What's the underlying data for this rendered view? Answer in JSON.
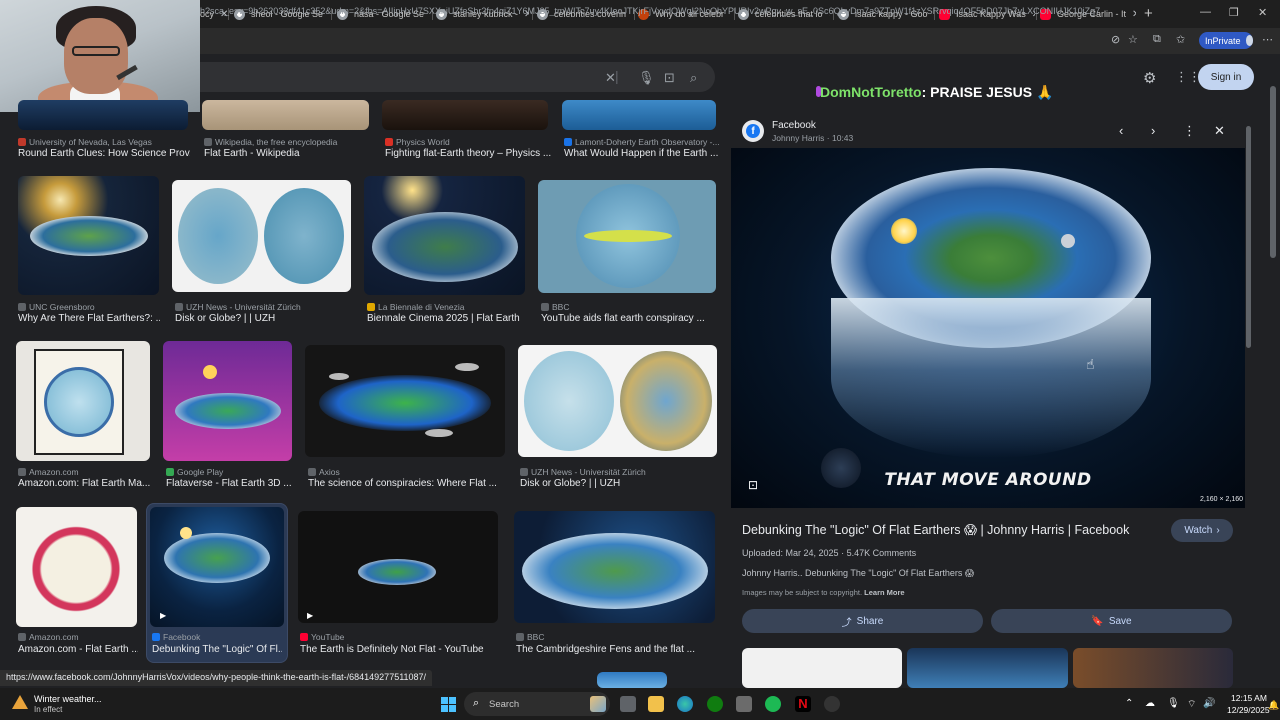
{
  "browser": {
    "tabs": [
      {
        "label": "ocy",
        "favicon": "google"
      },
      {
        "label": "sheol - Google Se",
        "favicon": "google"
      },
      {
        "label": "nasa - Google Se",
        "favicon": "google"
      },
      {
        "label": "stanley kubrick -",
        "favicon": "google"
      },
      {
        "label": "celebrities coverin",
        "favicon": "google"
      },
      {
        "label": "Why do all celebr",
        "favicon": "red"
      },
      {
        "label": "celebrities that lo",
        "favicon": "google"
      },
      {
        "label": "isaac kappy - Goo",
        "favicon": "google"
      },
      {
        "label": "Isaac Kappy Was",
        "favicon": "youtube"
      },
      {
        "label": "George Carlin - It",
        "favicon": "youtube"
      }
    ],
    "new_tab": "+",
    "address": "h?sca_esv=9b262033df41c352&udm=2&fbs=AIIjpHxU7SXXniUZfeShr2fp4giZ1Y6MJ25_tmWITc7uy4KIeoJTKjrFjVxydQWqI2NcOhYPURIv2wPgv_w_sE_0Sc6QLvDm7a9ZTpW1f1zYSRrvqiq4OF5bD07JhZyLXCONIUJK10jZg7B...",
    "inprivate_label": "InPrivate"
  },
  "webcam": {
    "description_icon": "webcam-overlay"
  },
  "results": [
    {
      "source": "University of Nevada, Las Vegas",
      "title": "Round Earth Clues: How Science Prov...",
      "fav": "#c0392b"
    },
    {
      "source": "Wikipedia, the free encyclopedia",
      "title": "Flat Earth - Wikipedia",
      "fav": "#9aa0a6"
    },
    {
      "source": "Physics World",
      "title": "Fighting flat-Earth theory – Physics ...",
      "fav": "#d93025"
    },
    {
      "source": "Lamont-Doherty Earth Observatory -...",
      "title": "What Would Happen if the Earth ...",
      "fav": "#1a73e8"
    },
    {
      "source": "UNC Greensboro",
      "title": "Why Are There Flat Earthers?: ...",
      "fav": "#9aa0a6"
    },
    {
      "source": "UZH News - Universität Zürich",
      "title": "Disk or Globe? | | UZH",
      "fav": "#9aa0a6"
    },
    {
      "source": "La Biennale di Venezia",
      "title": "Biennale Cinema 2025 | Flat Earth",
      "fav": "#9aa0a6"
    },
    {
      "source": "BBC",
      "title": "YouTube aids flat earth conspiracy ...",
      "fav": "#9aa0a6"
    },
    {
      "source": "Amazon.com",
      "title": "Amazon.com: Flat Earth Ma...",
      "fav": "#9aa0a6"
    },
    {
      "source": "Google Play",
      "title": "Flataverse - Flat Earth 3D ...",
      "fav": "#34a853"
    },
    {
      "source": "Axios",
      "title": "The science of conspiracies: Where Flat ...",
      "fav": "#9aa0a6"
    },
    {
      "source": "UZH News - Universität Zürich",
      "title": "Disk or Globe? | | UZH",
      "fav": "#9aa0a6"
    },
    {
      "source": "Amazon.com",
      "title": "Amazon.com - Flat Earth ...",
      "fav": "#9aa0a6"
    },
    {
      "source": "Facebook",
      "title": "Debunking The \"Logic\" Of Fl...",
      "fav": "#1877f2"
    },
    {
      "source": "YouTube",
      "title": "The Earth is Definitely Not Flat - YouTube",
      "fav": "#ff0033"
    },
    {
      "source": "BBC",
      "title": "The Cambridgeshire Fens and the flat ...",
      "fav": "#9aa0a6"
    }
  ],
  "panel": {
    "header_user": "DomNotToretto",
    "header_message": ": PRAISE JESUS 🙏",
    "signin_label": "Sign in",
    "source_name": "Facebook",
    "source_sub": "Johnny Harris · 10:43",
    "image_caption": "THAT MOVE AROUND",
    "image_dims": "2,160 × 2,160",
    "title": "Debunking The \"Logic\" Of Flat Earthers 😱 | Johnny Harris | Facebook",
    "watch_label": "Watch",
    "meta": "Uploaded: Mar 24, 2025 · 5.47K Comments",
    "description": "Johnny Harris.. Debunking The \"Logic\" Of Flat Earthers 😱",
    "copyright": "Images may be subject to copyright.",
    "learn_more": "Learn More",
    "share_label": "Share",
    "save_label": "Save"
  },
  "status_url": "https://www.facebook.com/JohnnyHarrisVox/videos/why-people-think-the-earth-is-flat-/684149277511087/",
  "taskbar": {
    "weather_line1": "Winter weather...",
    "weather_line2": "In effect",
    "search_label": "Search",
    "time": "12:15 AM",
    "date": "12/29/2025"
  }
}
